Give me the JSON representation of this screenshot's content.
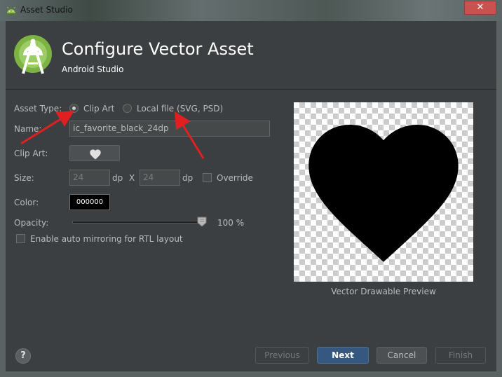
{
  "window": {
    "title": "Asset Studio",
    "close_glyph": "✕"
  },
  "header": {
    "title": "Configure Vector Asset",
    "subtitle": "Android Studio"
  },
  "form": {
    "asset_type_label": "Asset Type:",
    "asset_type_options": [
      {
        "label": "Clip Art",
        "selected": true
      },
      {
        "label": "Local file (SVG, PSD)",
        "selected": false
      }
    ],
    "name_label": "Name:",
    "name_value": "ic_favorite_black_24dp",
    "clip_art_label": "Clip Art:",
    "clip_art_icon": "heart-icon",
    "size_label": "Size:",
    "size_width": "24",
    "size_height": "24",
    "size_unit": "dp",
    "size_separator": "X",
    "override_label": "Override",
    "color_label": "Color:",
    "color_value": "000000",
    "opacity_label": "Opacity:",
    "opacity_percent": 100,
    "opacity_text": "100 %",
    "rtl_label": "Enable auto mirroring for RTL layout"
  },
  "preview": {
    "label": "Vector Drawable Preview",
    "icon": "heart-icon"
  },
  "footer": {
    "help_glyph": "?",
    "previous_label": "Previous",
    "next_label": "Next",
    "cancel_label": "Cancel",
    "finish_label": "Finish"
  },
  "colors": {
    "background": "#3c3f41",
    "accent": "#365880",
    "annotation_arrow": "#e02020",
    "close": "#c9514f"
  }
}
